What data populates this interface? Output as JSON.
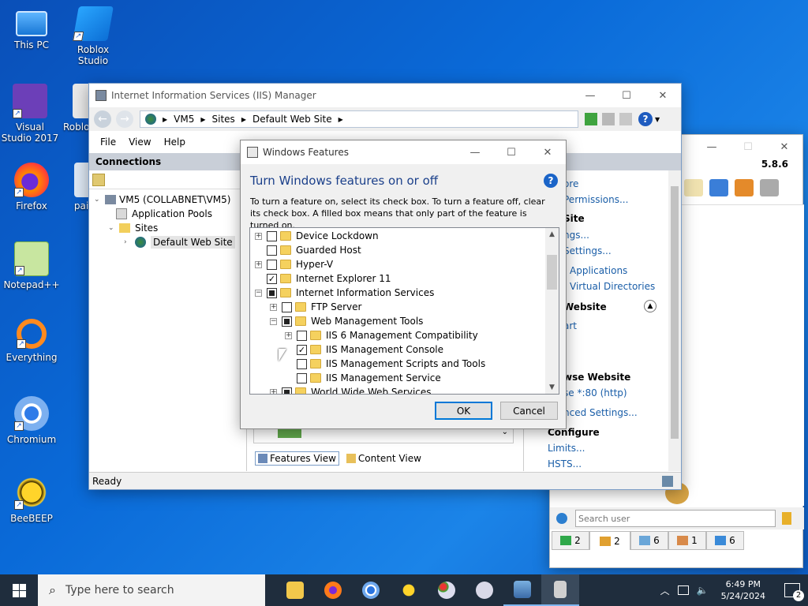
{
  "desktop": {
    "icons": [
      {
        "label": "This PC"
      },
      {
        "label": "Roblox Studio"
      },
      {
        "label": "Visual Studio 2017"
      },
      {
        "label": "Roblo"
      },
      {
        "label": "Firefox"
      },
      {
        "label": "pai"
      },
      {
        "label": "Notepad++"
      },
      {
        "label": "Everything"
      },
      {
        "label": "Chromium"
      },
      {
        "label": "BeeBEEP"
      }
    ]
  },
  "iis": {
    "title": "Internet Information Services (IIS) Manager",
    "address": [
      "VM5",
      "Sites",
      "Default Web Site"
    ],
    "menu": [
      "File",
      "View",
      "Help"
    ],
    "connections_label": "Connections",
    "tree": {
      "server": "VM5 (COLLABNET\\VM5)",
      "app_pools": "Application Pools",
      "sites": "Sites",
      "default_site": "Default Web Site"
    },
    "views": {
      "features": "Features View",
      "content": "Content View"
    },
    "status": "Ready",
    "actions": {
      "link_ore": "ore",
      "link_permissions": "Permissions...",
      "site_header": "Site",
      "link_ngs": "ngs...",
      "link_settings": "Settings...",
      "link_applications": "Applications",
      "link_vdirs": "Virtual Directories",
      "website_header": "Website",
      "link_art": "art",
      "browse_header": "wse Website",
      "browse_link": "se *:80 (http)",
      "link_advanced": "nced Settings...",
      "configure_header": "Configure",
      "link_limits": "Limits...",
      "link_hsts": "HSTS..."
    }
  },
  "beebeep": {
    "version": "5.8.6",
    "search_placeholder": "Search user",
    "tabs": [
      "2",
      "2",
      "6",
      "1",
      "6"
    ]
  },
  "dialog": {
    "title": "Windows Features",
    "heading": "Turn Windows features on or off",
    "description": "To turn a feature on, select its check box. To turn a feature off, clear its check box. A filled box means that only part of the feature is turned on.",
    "features": [
      {
        "label": "Device Lockdown"
      },
      {
        "label": "Guarded Host"
      },
      {
        "label": "Hyper-V"
      },
      {
        "label": "Internet Explorer 11"
      },
      {
        "label": "Internet Information Services"
      },
      {
        "label": "FTP Server"
      },
      {
        "label": "Web Management Tools"
      },
      {
        "label": "IIS 6 Management Compatibility"
      },
      {
        "label": "IIS Management Console"
      },
      {
        "label": "IIS Management Scripts and Tools"
      },
      {
        "label": "IIS Management Service"
      },
      {
        "label": "World Wide Web Services"
      }
    ],
    "ok": "OK",
    "cancel": "Cancel"
  },
  "taskbar": {
    "search_placeholder": "Type here to search",
    "time": "6:49 PM",
    "date": "5/24/2024",
    "notifications": "2"
  }
}
